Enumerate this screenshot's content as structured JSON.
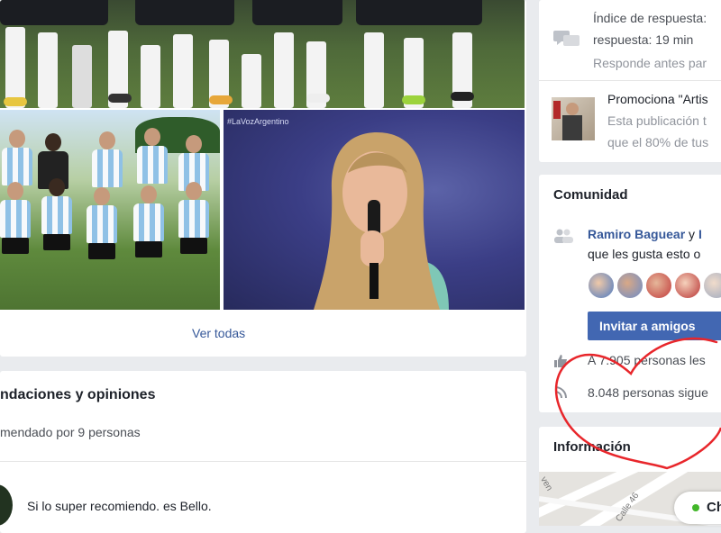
{
  "feed": {
    "photos_tag": "#LaVozArgentino",
    "view_all": "Ver todas",
    "recommendations": {
      "title": "ndaciones y opiniones",
      "subtitle": "mendado por 9 personas",
      "review_text": "Si lo super recomiendo. es Bello."
    }
  },
  "sidebar": {
    "response": {
      "line1": "Índice de respuesta:",
      "line2": "respuesta: 19 min",
      "line3": "Responde antes par"
    },
    "promo": {
      "title": "Promociona \"Artis",
      "line1": "Esta publicación t",
      "line2": "que el 80% de tus"
    },
    "community": {
      "title": "Comunidad",
      "friends_name": "Ramiro Baguear",
      "friends_tail": " y ",
      "friends_cut": "I",
      "friends_line2": "que les gusta esto o",
      "invite_button": "Invitar a amigos",
      "likes": "A 7.905 personas les",
      "follows": "8.048 personas sigue"
    },
    "info": {
      "title": "Información",
      "map_street": "Calle 46",
      "map_street2": "ven"
    },
    "chat_label": "Ch"
  },
  "colors": {
    "link": "#365899",
    "button": "#4267b2",
    "heart": "#e8262b",
    "online": "#42b72a"
  }
}
